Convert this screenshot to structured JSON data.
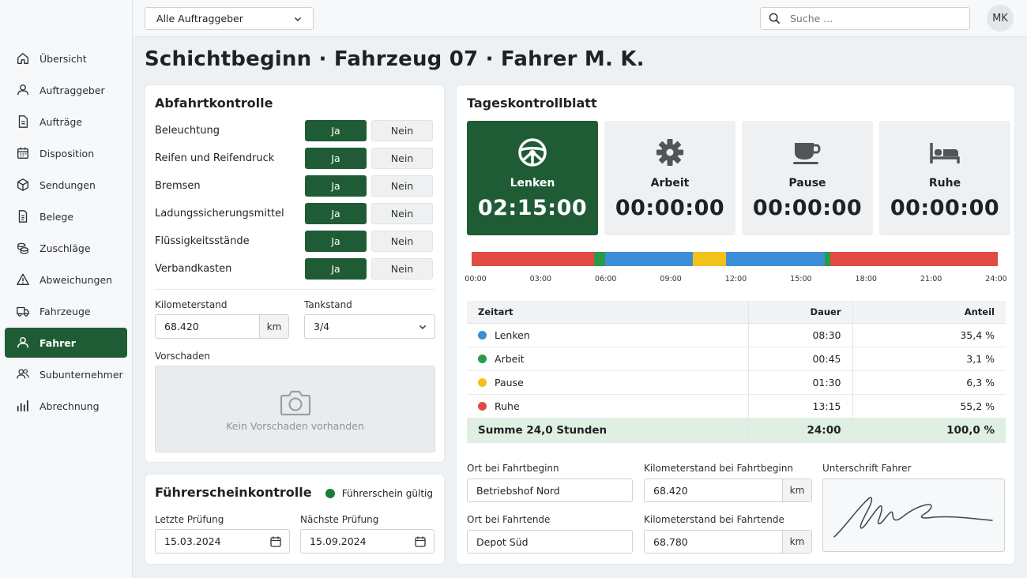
{
  "header": {
    "client_select": "Alle Auftraggeber",
    "search_placeholder": "Suche ...",
    "avatar_initials": "MK"
  },
  "sidebar": {
    "items": [
      {
        "label": "Übersicht",
        "icon": "home-icon",
        "active": false
      },
      {
        "label": "Auftraggeber",
        "icon": "user-icon",
        "active": false
      },
      {
        "label": "Aufträge",
        "icon": "document-icon",
        "active": false
      },
      {
        "label": "Disposition",
        "icon": "calendar-icon",
        "active": false
      },
      {
        "label": "Sendungen",
        "icon": "package-icon",
        "active": false
      },
      {
        "label": "Belege",
        "icon": "receipt-icon",
        "active": false
      },
      {
        "label": "Zuschläge",
        "icon": "coins-icon",
        "active": false
      },
      {
        "label": "Abweichungen",
        "icon": "warning-icon",
        "active": false
      },
      {
        "label": "Fahrzeuge",
        "icon": "truck-icon",
        "active": false
      },
      {
        "label": "Fahrer",
        "icon": "driver-icon",
        "active": true
      },
      {
        "label": "Subunternehmer",
        "icon": "users-icon",
        "active": false
      },
      {
        "label": "Abrechnung",
        "icon": "bar-chart-icon",
        "active": false
      }
    ]
  },
  "page": {
    "title": "Schichtbeginn · Fahrzeug 07 · Fahrer M. K."
  },
  "departure_check": {
    "title": "Abfahrtkontrolle",
    "yes_label": "Ja",
    "no_label": "Nein",
    "items": [
      {
        "label": "Beleuchtung",
        "value": "Ja"
      },
      {
        "label": "Reifen und Reifendruck",
        "value": "Ja"
      },
      {
        "label": "Bremsen",
        "value": "Ja"
      },
      {
        "label": "Ladungssicherungsmittel",
        "value": "Ja"
      },
      {
        "label": "Flüssigkeitsstände",
        "value": "Ja"
      },
      {
        "label": "Verbandkasten",
        "value": "Ja"
      }
    ],
    "km_label": "Kilometerstand",
    "km_value": "68.420",
    "km_unit": "km",
    "tank_label": "Tankstand",
    "tank_value": "3/4",
    "damage_label": "Vorschaden",
    "damage_empty": "Kein Vorschaden vorhanden"
  },
  "license_check": {
    "title": "Führerscheinkontrolle",
    "status": "Führerschein gültig",
    "status_color": "#1f7a3a",
    "last_label": "Letzte Prüfung",
    "last_value": "15.03.2024",
    "next_label": "Nächste Prüfung",
    "next_value": "15.09.2024"
  },
  "daily_sheet": {
    "title": "Tageskontrollblatt",
    "tiles": [
      {
        "label": "Lenken",
        "value": "02:15:00",
        "icon": "steering-wheel-icon",
        "active": true
      },
      {
        "label": "Arbeit",
        "value": "00:00:00",
        "icon": "gear-icon",
        "active": false
      },
      {
        "label": "Pause",
        "value": "00:00:00",
        "icon": "coffee-cup-icon",
        "active": false
      },
      {
        "label": "Ruhe",
        "value": "00:00:00",
        "icon": "bed-icon",
        "active": false
      }
    ],
    "colors": {
      "lenken": "#3b8fd9",
      "arbeit": "#2a9a48",
      "pause": "#f2c21b",
      "ruhe": "#e04b43"
    },
    "timeline_segments": [
      {
        "type": "ruhe",
        "hours": 5.6
      },
      {
        "type": "arbeit",
        "hours": 0.5
      },
      {
        "type": "lenken",
        "hours": 4.0
      },
      {
        "type": "pause",
        "hours": 1.5
      },
      {
        "type": "lenken",
        "hours": 4.5
      },
      {
        "type": "arbeit",
        "hours": 0.25
      },
      {
        "type": "ruhe",
        "hours": 7.65
      }
    ],
    "timeline_ticks": [
      "00:00",
      "03:00",
      "06:00",
      "09:00",
      "12:00",
      "15:00",
      "18:00",
      "21:00",
      "24:00"
    ],
    "table": {
      "headers": [
        "Zeitart",
        "Dauer",
        "Anteil"
      ],
      "rows": [
        {
          "type": "lenken",
          "label": "Lenken",
          "dauer": "08:30",
          "anteil": "35,4  %"
        },
        {
          "type": "arbeit",
          "label": "Arbeit",
          "dauer": "00:45",
          "anteil": "3,1  %"
        },
        {
          "type": "pause",
          "label": "Pause",
          "dauer": "01:30",
          "anteil": "6,3  %"
        },
        {
          "type": "ruhe",
          "label": "Ruhe",
          "dauer": "13:15",
          "anteil": "55,2  %"
        }
      ],
      "sum": {
        "label": "Summe 24,0 Stunden",
        "dauer": "24:00",
        "anteil": "100,0  %"
      }
    },
    "start_place_label": "Ort bei Fahrtbeginn",
    "start_place": "Betriebshof Nord",
    "end_place_label": "Ort bei Fahrtende",
    "end_place": "Depot Süd",
    "start_km_label": "Kilometerstand bei Fahrtbeginn",
    "start_km": "68.420",
    "end_km_label": "Kilometerstand bei Fahrtende",
    "end_km": "68.780",
    "km_unit": "km",
    "signature_label": "Unterschrift Fahrer"
  }
}
